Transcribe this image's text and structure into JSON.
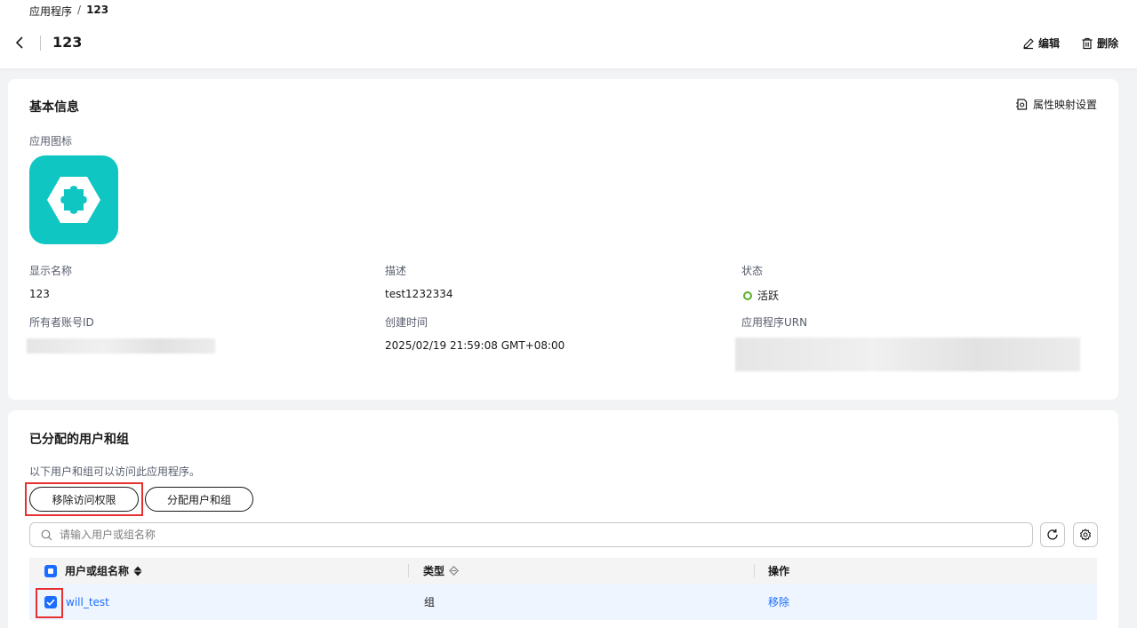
{
  "breadcrumb": {
    "parent": "应用程序",
    "separator": "/",
    "current": "123"
  },
  "header": {
    "title": "123",
    "edit_label": "编辑",
    "delete_label": "删除"
  },
  "basic_info": {
    "title": "基本信息",
    "mapping_label": "属性映射设置",
    "icon_label": "应用图标",
    "icon_color": "#0fc6c2",
    "display_name_label": "显示名称",
    "display_name": "123",
    "description_label": "描述",
    "description": "test1232334",
    "status_label": "状态",
    "status": "活跃",
    "status_color": "#5ab12a",
    "owner_label": "所有者账号ID",
    "created_label": "创建时间",
    "created": "2025/02/19 21:59:08 GMT+08:00",
    "urn_label": "应用程序URN"
  },
  "assigned": {
    "title": "已分配的用户和组",
    "subtitle": "以下用户和组可以访问此应用程序。",
    "remove_access_label": "移除访问权限",
    "assign_label": "分配用户和组",
    "search_placeholder": "请输入用户或组名称",
    "columns": {
      "name": "用户或组名称",
      "type": "类型",
      "action": "操作"
    },
    "rows": [
      {
        "name": "will_test",
        "type": "组",
        "action": "移除"
      }
    ]
  },
  "colors": {
    "accent": "#1a6dff",
    "highlight": "#e63131"
  }
}
